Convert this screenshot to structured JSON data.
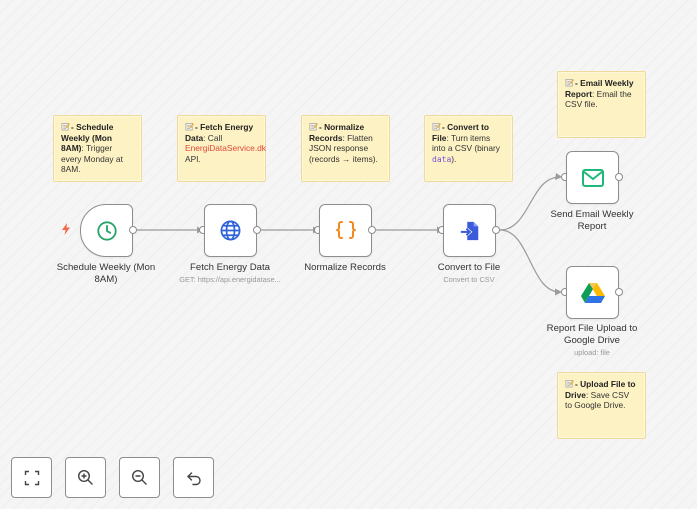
{
  "notes": {
    "schedule": {
      "title": "- Schedule Weekly (Mon 8AM)",
      "body": ": Trigger every Monday at 8AM."
    },
    "fetch": {
      "title": "- Fetch Energy Data",
      "body_pre": ": Call ",
      "link": "EnergiDataService.dk",
      "body_post": " API."
    },
    "normalize": {
      "title": "- Normalize Records",
      "body": ": Flatten JSON response (records → items)."
    },
    "convert": {
      "title": "- Convert to File",
      "body_pre": ": Turn items into a CSV (binary ",
      "code": "data",
      "body_post": ")."
    },
    "email": {
      "title": "- Email Weekly Report",
      "body": ": Email the CSV file."
    },
    "upload": {
      "title": "- Upload File to Drive",
      "body": ": Save CSV to Google Drive."
    }
  },
  "nodes": {
    "schedule": {
      "label": "Schedule Weekly (Mon 8AM)"
    },
    "fetch": {
      "label": "Fetch Energy Data",
      "sub": "GET: https://api.energidatase..."
    },
    "normalize": {
      "label": "Normalize Records"
    },
    "convert": {
      "label": "Convert to File",
      "sub": "Convert to CSV"
    },
    "email": {
      "label": "Send Email Weekly Report"
    },
    "drive": {
      "label": "Report File Upload to Google Drive",
      "sub": "upload: file"
    }
  },
  "colors": {
    "schedule": "#27a36b",
    "fetch": "#2f62d8",
    "normalize": "#f08a1d",
    "convert": "#3b5bdb",
    "email": "#1fb77a",
    "trigger_bolt": "#ef6b4d"
  },
  "icons": {
    "schedule": "clock-icon",
    "fetch": "globe-icon",
    "normalize": "curly-braces-icon",
    "convert": "file-import-icon",
    "email": "envelope-icon",
    "drive": "google-drive-icon",
    "trigger": "lightning-bolt-icon",
    "note": "memo-icon"
  },
  "controls": [
    {
      "name": "fit-view-button",
      "icon": "fit-view-icon"
    },
    {
      "name": "zoom-in-button",
      "icon": "zoom-in-icon"
    },
    {
      "name": "zoom-out-button",
      "icon": "zoom-out-icon"
    },
    {
      "name": "undo-button",
      "icon": "undo-icon"
    }
  ]
}
